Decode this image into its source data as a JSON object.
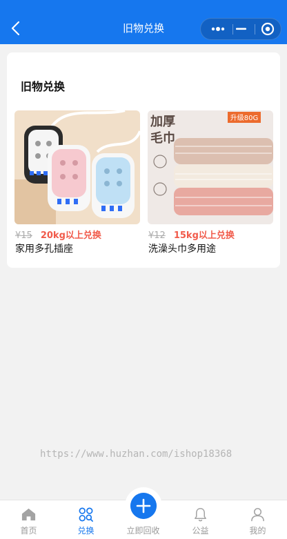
{
  "nav": {
    "title": "旧物兑换",
    "back_icon": "chevron-left-icon",
    "more_icon": "more-dots-icon",
    "minimize_icon": "minimize-icon",
    "close_icon": "target-close-icon"
  },
  "section": {
    "title": "旧物兑换",
    "items": [
      {
        "old_price": "¥15",
        "condition": "20kg以上兑换",
        "name": "家用多孔插座"
      },
      {
        "old_price": "¥12",
        "condition": "15kg以上兑换",
        "name": "洗澡头巾多用途",
        "image_text": "加厚 毛巾",
        "badge": "升级80G"
      }
    ]
  },
  "watermark": "https://www.huzhan.com/ishop18368",
  "tabbar": {
    "tabs": [
      {
        "label": "首页",
        "icon": "home-icon"
      },
      {
        "label": "兑换",
        "icon": "exchange-icon"
      },
      {
        "label": "立即回收",
        "icon": "plus-icon"
      },
      {
        "label": "公益",
        "icon": "bell-icon"
      },
      {
        "label": "我的",
        "icon": "user-icon"
      }
    ],
    "active": "兑换"
  },
  "colors": {
    "primary": "#1677ee",
    "accent_red": "#f15a4a",
    "background": "#f2f2f2"
  }
}
